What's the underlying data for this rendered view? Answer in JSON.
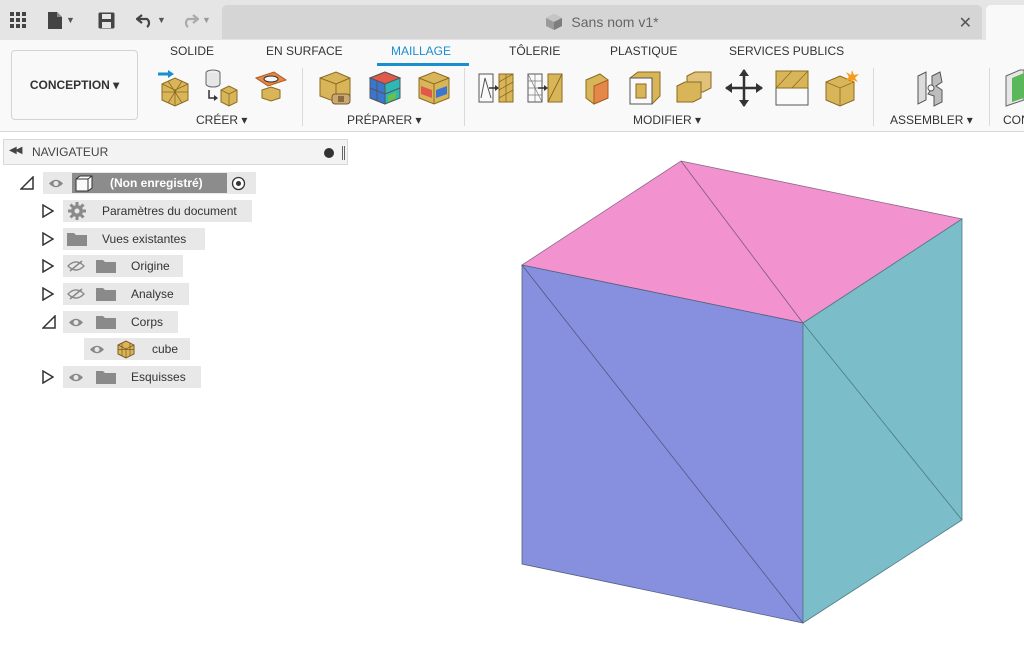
{
  "title_bar": {
    "document_title": "Sans nom v1*",
    "close_symbol": "✕"
  },
  "workspace": {
    "label": "CONCEPTION ▾"
  },
  "tabs": [
    {
      "label": "SOLIDE",
      "active": false
    },
    {
      "label": "EN SURFACE",
      "active": false
    },
    {
      "label": "MAILLAGE",
      "active": true
    },
    {
      "label": "TÔLERIE",
      "active": false
    },
    {
      "label": "PLASTIQUE",
      "active": false
    },
    {
      "label": "SERVICES PUBLICS",
      "active": false
    }
  ],
  "groups": {
    "create": "CRÉER ▾",
    "prepare": "PRÉPARER ▾",
    "modify": "MODIFIER ▾",
    "assemble": "ASSEMBLER ▾",
    "construct_partial": "CON"
  },
  "navigator": {
    "title": "NAVIGATEUR",
    "root_label": "(Non enregistré)",
    "items": [
      {
        "label": "Paramètres du document"
      },
      {
        "label": "Vues existantes"
      },
      {
        "label": "Origine"
      },
      {
        "label": "Analyse"
      },
      {
        "label": "Corps"
      },
      {
        "label": "cube"
      },
      {
        "label": "Esquisses"
      }
    ]
  },
  "colors": {
    "accent": "#1a8fd0",
    "mesh_top": "#f293cf",
    "mesh_front": "#8690df",
    "mesh_right": "#7bbdc9",
    "mesh_icon_gold": "#d9b55a"
  }
}
